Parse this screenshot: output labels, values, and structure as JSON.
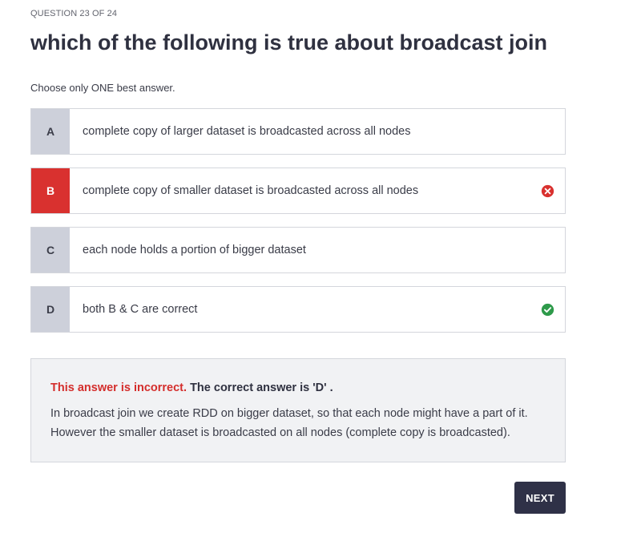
{
  "quiz": {
    "counter": "QUESTION 23 OF 24",
    "question": "which of the following is true about broadcast join",
    "instruction": "Choose only ONE best answer.",
    "options": [
      {
        "letter": "A",
        "text": "complete copy of larger dataset is broadcasted across all nodes",
        "status": "none"
      },
      {
        "letter": "B",
        "text": "complete copy of smaller dataset is broadcasted across all nodes",
        "status": "selected-incorrect",
        "status_icon": "x-circle-icon"
      },
      {
        "letter": "C",
        "text": "each node holds a portion of bigger dataset",
        "status": "none"
      },
      {
        "letter": "D",
        "text": "both B & C are correct",
        "status": "correct",
        "status_icon": "check-circle-icon"
      }
    ]
  },
  "feedback": {
    "incorrect_label": "This answer is incorrect.",
    "correct_answer_text": "The correct answer is 'D' .",
    "explanation_line1": "In broadcast join we create RDD on bigger dataset, so that each node might have a part of it.",
    "explanation_line2": "However the smaller dataset is broadcasted on all nodes (complete copy is broadcasted)."
  },
  "actions": {
    "next_label": "NEXT"
  },
  "colors": {
    "incorrect": "#d9312f",
    "correct": "#2e9a4a",
    "letter_bg": "#cdd0da",
    "button_bg": "#2f3147"
  }
}
